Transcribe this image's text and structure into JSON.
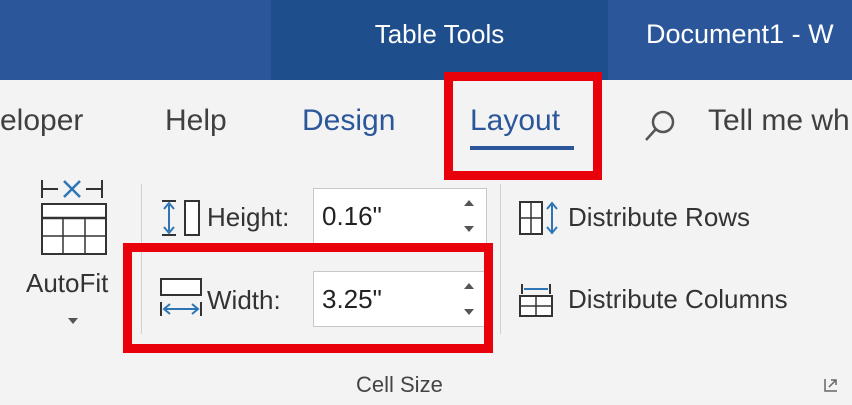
{
  "title_bar": {
    "contextual_tab": "Table Tools",
    "document_title": "Document1  -  W"
  },
  "ribbon_tabs": {
    "developer": "eloper",
    "help": "Help",
    "design": "Design",
    "layout": "Layout",
    "tell_me": "Tell me wh"
  },
  "autofit": {
    "label": "AutoFit"
  },
  "cell_size": {
    "height_label": "Height:",
    "height_value": "0.16\"",
    "width_label": "Width:",
    "width_value": "3.25\"",
    "group_title": "Cell Size"
  },
  "distribute": {
    "rows_label": "Distribute Rows",
    "columns_label": "Distribute Columns"
  },
  "colors": {
    "title_bar": "#2b579a",
    "contextual": "#1e4e8c",
    "accent": "#2b579a",
    "highlight": "#e8000a"
  }
}
